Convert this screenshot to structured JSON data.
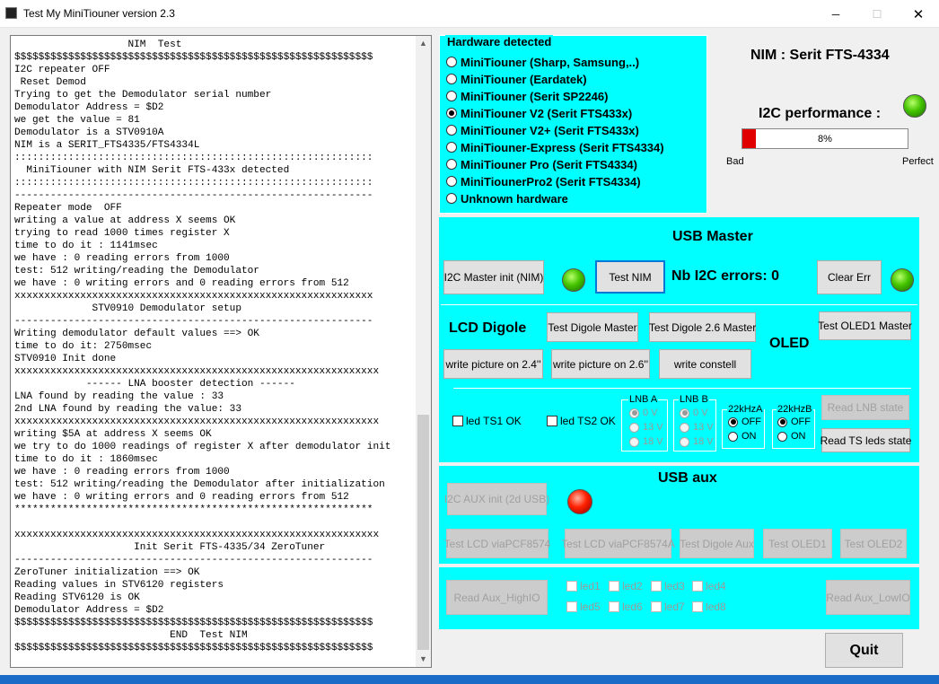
{
  "window": {
    "title": "Test My MiniTiouner version 2.3",
    "minimize": "─",
    "maximize": "☐",
    "close": "✕"
  },
  "log": [
    "                   NIM  Test",
    "$$$$$$$$$$$$$$$$$$$$$$$$$$$$$$$$$$$$$$$$$$$$$$$$$$$$$$$$$$$$",
    "I2C repeater OFF",
    " Reset Demod",
    "Trying to get the Demodulator serial number",
    "Demodulator Address = $D2",
    "we get the value = 81",
    "Demodulator is a STV0910A",
    "NIM is a SERIT_FTS4335/FTS4334L",
    "::::::::::::::::::::::::::::::::::::::::::::::::::::::::::::",
    "  MiniTiouner with NIM Serit FTS-433x detected",
    "::::::::::::::::::::::::::::::::::::::::::::::::::::::::::::",
    "------------------------------------------------------------",
    "Repeater mode  OFF",
    "writing a value at address X seems OK",
    "trying to read 1000 times register X",
    "time to do it : 1141msec",
    "we have : 0 reading errors from 1000",
    "test: 512 writing/reading the Demodulator",
    "we have : 0 writing errors and 0 reading errors from 512",
    "xxxxxxxxxxxxxxxxxxxxxxxxxxxxxxxxxxxxxxxxxxxxxxxxxxxxxxxxxxxx",
    "             STV0910 Demodulator setup",
    "------------------------------------------------------------",
    "Writing demodulator default values ==> OK",
    "time to do it: 2750msec",
    "STV0910 Init done",
    "xxxxxxxxxxxxxxxxxxxxxxxxxxxxxxxxxxxxxxxxxxxxxxxxxxxxxxxxxxxxx",
    "            ------ LNA booster detection ------",
    "LNA found by reading the value : 33",
    "2nd LNA found by reading the value: 33",
    "xxxxxxxxxxxxxxxxxxxxxxxxxxxxxxxxxxxxxxxxxxxxxxxxxxxxxxxxxxxxx",
    "writing $5A at address X seems OK",
    "we try to do 1000 readings of register X after demodulator init",
    "time to do it : 1860msec",
    "we have : 0 reading errors from 1000",
    "test: 512 writing/reading the Demodulator after initialization",
    "we have : 0 writing errors and 0 reading errors from 512",
    "************************************************************",
    "",
    "xxxxxxxxxxxxxxxxxxxxxxxxxxxxxxxxxxxxxxxxxxxxxxxxxxxxxxxxxxxxx",
    "                    Init Serit FTS-4335/34 ZeroTuner",
    "------------------------------------------------------------",
    "ZeroTuner initialization ==> OK",
    "Reading values in STV6120 registers",
    "Reading STV6120 is OK",
    "Demodulator Address = $D2",
    "$$$$$$$$$$$$$$$$$$$$$$$$$$$$$$$$$$$$$$$$$$$$$$$$$$$$$$$$$$$$",
    "                          END  Test NIM",
    "$$$$$$$$$$$$$$$$$$$$$$$$$$$$$$$$$$$$$$$$$$$$$$$$$$$$$$$$$$$$"
  ],
  "scroll": {
    "up": "▲",
    "down": "▼"
  },
  "hardware": {
    "legend": "Hardware detected",
    "options": [
      {
        "label": "MiniTiouner (Sharp, Samsung,..)",
        "checked": false
      },
      {
        "label": "MiniTiouner (Eardatek)",
        "checked": false
      },
      {
        "label": "MiniTiouner (Serit SP2246)",
        "checked": false
      },
      {
        "label": "MiniTiouner V2 (Serit FTS433x)",
        "checked": true
      },
      {
        "label": "MiniTiouner V2+ (Serit FTS433x)",
        "checked": false
      },
      {
        "label": "MiniTiouner-Express (Serit FTS4334)",
        "checked": false
      },
      {
        "label": "MiniTiouner Pro  (Serit FTS4334)",
        "checked": false
      },
      {
        "label": "MiniTiounerPro2 (Serit FTS4334)",
        "checked": false
      },
      {
        "label": "Unknown hardware",
        "checked": false
      }
    ]
  },
  "nim": {
    "label": "NIM : Serit FTS-4334"
  },
  "i2c_perf": {
    "label": "I2C performance :",
    "value_text": "8%",
    "value": 0.08,
    "bad": "Bad",
    "perfect": "Perfect"
  },
  "usb_master": {
    "title": "USB Master",
    "i2c_init": "I2C Master init (NIM)",
    "test_nim": "Test NIM",
    "errors_label": "Nb I2C errors:  0",
    "clear_err": "Clear Err",
    "lcd_label": "LCD Digole",
    "test_digole_master": "Test Digole Master",
    "test_digole_26": "Test Digole 2.6 Master",
    "test_oled1_master": "Test OLED1 Master",
    "oled_label": "OLED",
    "write_24": "write picture on 2.4''",
    "write_26": "write picture on 2.6''",
    "write_constell": "write constell",
    "led_ts1": "led TS1 OK",
    "led_ts2": "led TS2 OK",
    "lnb_a": {
      "title": "LNB A",
      "options": [
        "0 V",
        "13 V",
        "18 V"
      ]
    },
    "lnb_b": {
      "title": "LNB B",
      "options": [
        "0 V",
        "13 V",
        "18 V"
      ]
    },
    "k22a": {
      "title": "22kHzA",
      "off": "OFF",
      "on": "ON"
    },
    "k22b": {
      "title": "22kHzB",
      "off": "OFF",
      "on": "ON"
    },
    "read_lnb": "Read LNB state",
    "read_ts": "Read TS leds state"
  },
  "usb_aux": {
    "title": "USB aux",
    "i2c_aux_init": "I2C AUX init (2d USB)",
    "test_lcd_1": "Test LCD viaPCF8574",
    "test_lcd_2": "Test LCD viaPCF8574A",
    "test_digole_aux": "Test Digole Aux",
    "test_oled1": "Test OLED1",
    "test_oled2": "Test OLED2",
    "read_high": "Read Aux_HighIO",
    "read_low": "Read Aux_LowIO",
    "leds": [
      "led1",
      "led2",
      "led3",
      "led4",
      "led5",
      "led6",
      "led7",
      "led8"
    ]
  },
  "quit": "Quit"
}
